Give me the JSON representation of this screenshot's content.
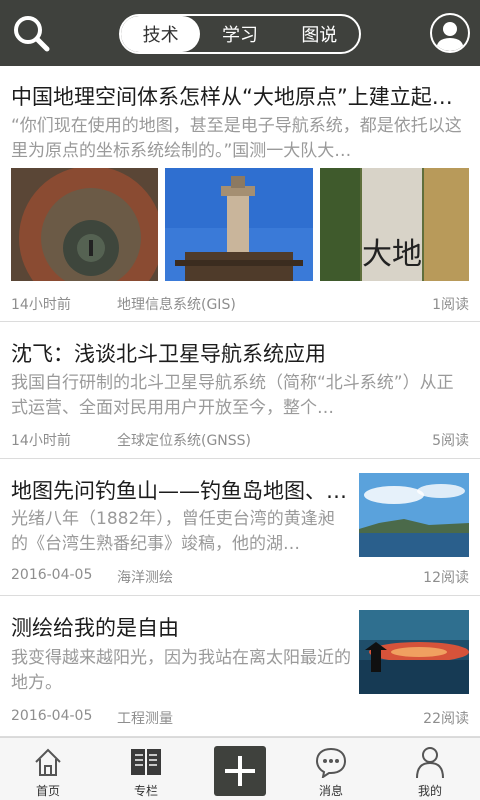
{
  "header": {
    "tabs": [
      {
        "label": "技术",
        "active": true
      },
      {
        "label": "学习",
        "active": false
      },
      {
        "label": "图说",
        "active": false
      }
    ],
    "search_icon": "search-icon",
    "avatar_icon": "user-icon"
  },
  "articles": [
    {
      "title": "中国地理空间体系怎样从“大地原点”上建立起…",
      "summary": "“你们现在使用的地图，甚至是电子导航系统，都是依托以这里为原点的坐标系统绘制的。”国测一大队大…",
      "time": "14小时前",
      "category": "地理信息系统(GIS)",
      "reads": "1阅读",
      "thumbs": [
        "seal-photo",
        "tower-photo",
        "plaque-photo"
      ],
      "plaque_text": "大地"
    },
    {
      "title": "沈飞：浅谈北斗卫星导航系统应用",
      "summary": "我国自行研制的北斗卫星导航系统（简称“北斗系统”）从正式运营、全面对民用用户开放至今，整个…",
      "time": "14小时前",
      "category": "全球定位系统(GNSS)",
      "reads": "5阅读"
    },
    {
      "title": "地图先问钓鱼山——钓鱼岛地图、…",
      "summary": "光绪八年（1882年），曾任吏台湾的黄逢昶的《台湾生熟番纪事》竣稿，他的湖…",
      "time": "2016-04-05",
      "category": "海洋测绘",
      "reads": "12阅读",
      "thumb": "island-photo"
    },
    {
      "title": "测绘给我的是自由",
      "summary": "我变得越来越阳光，因为我站在离太阳最近的地方。",
      "time": "2016-04-05",
      "category": "工程测量",
      "reads": "22阅读",
      "thumb": "sunset-photo"
    }
  ],
  "bottom_nav": [
    {
      "label": "首页",
      "icon": "home-icon"
    },
    {
      "label": "专栏",
      "icon": "book-icon"
    },
    {
      "label": "",
      "icon": "plus-icon"
    },
    {
      "label": "消息",
      "icon": "message-icon"
    },
    {
      "label": "我的",
      "icon": "user-icon"
    }
  ],
  "colors": {
    "header_bg": "#3f413d",
    "title_text": "#1c1c1c",
    "summary_text": "#9a9a9a",
    "meta_text": "#8e8e8e"
  }
}
